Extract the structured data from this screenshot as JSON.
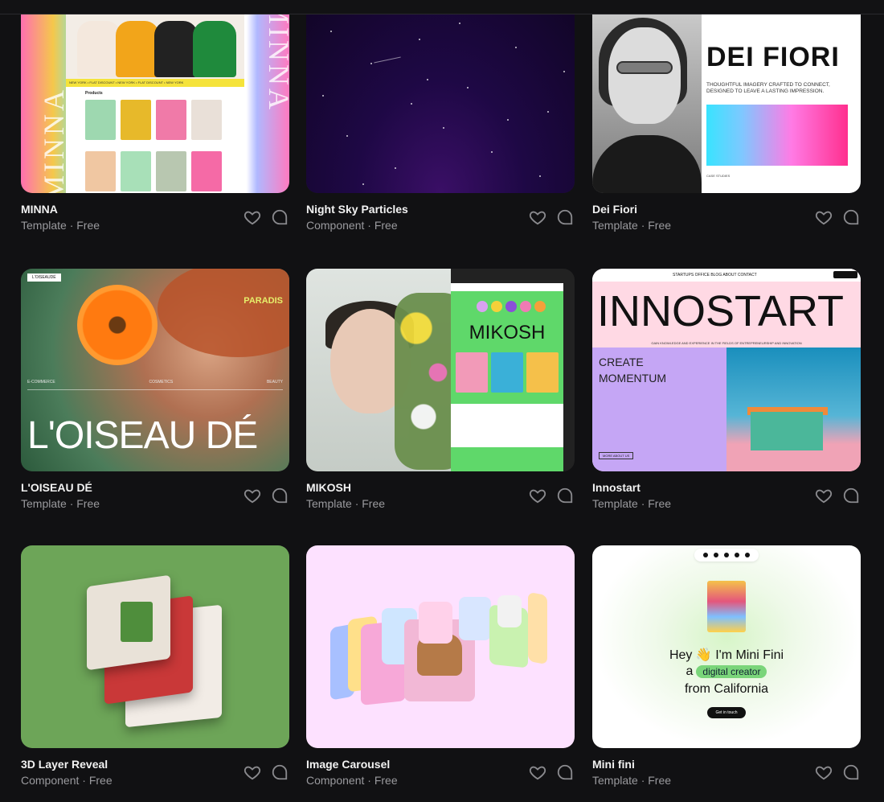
{
  "cards": [
    {
      "title": "MINNA",
      "subtitle": "Template · Free"
    },
    {
      "title": "Night Sky Particles",
      "subtitle": "Component · Free"
    },
    {
      "title": "Dei Fiori",
      "subtitle": "Template · Free"
    },
    {
      "title": "L'OISEAU DÉ",
      "subtitle": "Template · Free"
    },
    {
      "title": "MIKOSH",
      "subtitle": "Template · Free"
    },
    {
      "title": "Innostart",
      "subtitle": "Template · Free"
    },
    {
      "title": "3D Layer Reveal",
      "subtitle": "Component · Free"
    },
    {
      "title": "Image Carousel",
      "subtitle": "Component · Free"
    },
    {
      "title": "Mini fini",
      "subtitle": "Template · Free"
    }
  ],
  "previews": {
    "minna": {
      "side_text": "MINNA",
      "ticker": "NEW YORK • FLAT DISCOUNT • NEW YORK • FLAT DISCOUNT • NEW YORK",
      "products_label": "Products"
    },
    "dei": {
      "logo": "DEI FIORI",
      "tagline": "THOUGHTFUL IMAGERY CRAFTED TO CONNECT, DESIGNED TO LEAVE A LASTING IMPRESSION.",
      "case": "CASE STUDIES"
    },
    "oiseau": {
      "brand": "L'OISEAUDÉ",
      "paradis": "PARADIS",
      "nav": [
        "E-COMMERCE",
        "COSMETICS",
        "BEAUTY"
      ],
      "title": "L'OISEAU DÉ"
    },
    "mikosh": {
      "logo": "MIKOSH"
    },
    "inno": {
      "title": "INNOSTART",
      "sub": "GAIN KNOWLEDGE AND EXPERIENCE IN THE FIELDS OF ENTREPRENEURSHIP AND INNOVATION",
      "create": "CREATE",
      "momentum": "MOMENTUM",
      "more": "MORE ABOUT US",
      "nav": "STARTUPS   OFFICE   BLOG   ABOUT   CONTACT"
    },
    "mini": {
      "line1": "Hey 👋 I'm Mini Fini",
      "line2_pre": "a",
      "tag": "digital creator",
      "line3": "from California",
      "button": "Get in touch"
    }
  },
  "colors": {
    "background": "#111113",
    "title": "#f2f2f2",
    "subtitle": "#9a9a9e",
    "icon": "#8a8a8e"
  }
}
